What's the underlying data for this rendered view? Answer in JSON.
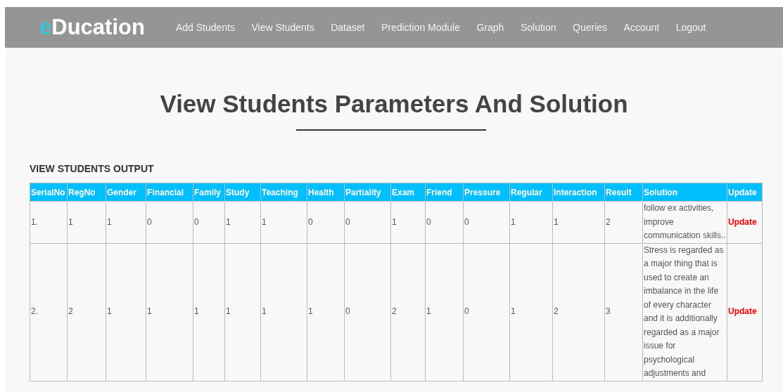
{
  "logo": {
    "accent": "e",
    "rest": "Ducation"
  },
  "nav": [
    "Add Students",
    "View Students",
    "Dataset",
    "Prediction Module",
    "Graph",
    "Solution",
    "Queries",
    "Account",
    "Logout"
  ],
  "title": "View Students Parameters And Solution",
  "section": "VIEW STUDENTS OUTPUT",
  "table": {
    "columns": [
      "SerialNo",
      "RegNo",
      "Gender",
      "Financial",
      "Family",
      "Study",
      "Teaching",
      "Health",
      "Partiality",
      "Exam",
      "Friend",
      "Pressure",
      "Regular",
      "Interaction",
      "Result",
      "Solution",
      "Update"
    ],
    "rows": [
      {
        "cells": [
          "1.",
          "1",
          "1",
          "0",
          "0",
          "1",
          "1",
          "0",
          "0",
          "1",
          "0",
          "0",
          "1",
          "1",
          "2"
        ],
        "solution": "follow ex activities, improve communication skills..",
        "action": "Update"
      },
      {
        "cells": [
          "2.",
          "2",
          "1",
          "1",
          "1",
          "1",
          "1",
          "1",
          "0",
          "2",
          "1",
          "0",
          "1",
          "2",
          "3"
        ],
        "solution": "Stress is regarded as a major thing that is used to create an imbalance in the life of every character and it is additionally regarded as a major issue for psychological adjustments and",
        "action": "Update"
      }
    ]
  }
}
